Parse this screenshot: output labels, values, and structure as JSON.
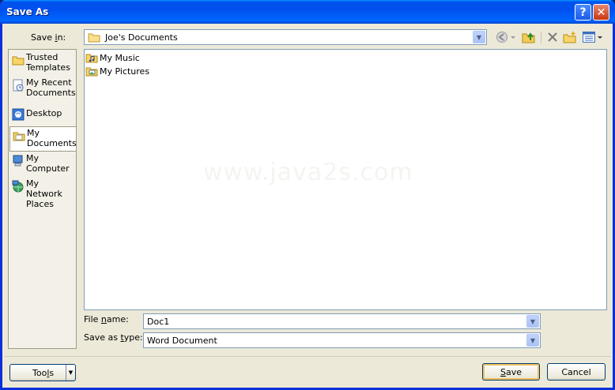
{
  "window": {
    "title": "Save As",
    "help_glyph": "?",
    "close_glyph": "✕"
  },
  "save_in": {
    "label_pre": "Save ",
    "label_ul": "i",
    "label_post": "n:",
    "value": "Joe's Documents"
  },
  "places": [
    {
      "name": "trusted-templates",
      "line1": "Trusted",
      "line2": "Templates",
      "icon": "folder-icon"
    },
    {
      "name": "my-recent-documents",
      "line1": "My Recent",
      "line2": "Documents",
      "icon": "recent-documents-icon"
    },
    {
      "name": "desktop",
      "line1": "Desktop",
      "line2": "",
      "icon": "desktop-icon"
    },
    {
      "name": "my-documents",
      "line1": "My",
      "line2": "Documents",
      "icon": "my-documents-icon"
    },
    {
      "name": "my-computer",
      "line1": "My",
      "line2": "Computer",
      "icon": "computer-icon"
    },
    {
      "name": "my-network-places",
      "line1": "My Network",
      "line2": "Places",
      "icon": "network-icon"
    }
  ],
  "files": [
    {
      "name": "My Music",
      "icon": "music-folder-icon"
    },
    {
      "name": "My Pictures",
      "icon": "pictures-folder-icon"
    }
  ],
  "watermark": "www.java2s.com",
  "file_name": {
    "label_pre": "File ",
    "label_ul": "n",
    "label_post": "ame:",
    "value": "Doc1"
  },
  "save_as_type": {
    "label_pre": "Save as ",
    "label_ul": "t",
    "label_post": "ype:",
    "value": "Word Document"
  },
  "buttons": {
    "tools_pre": "Too",
    "tools_ul": "l",
    "tools_post": "s",
    "save_ul": "S",
    "save_post": "ave",
    "cancel": "Cancel"
  }
}
